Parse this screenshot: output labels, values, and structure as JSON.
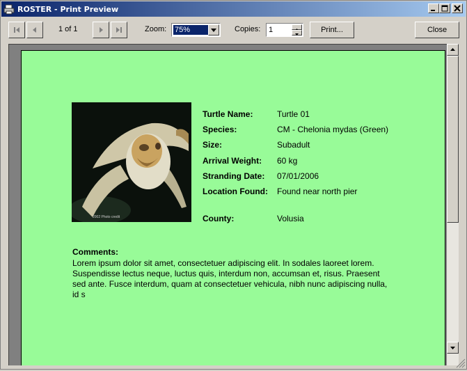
{
  "window": {
    "title": "ROSTER - Print Preview"
  },
  "toolbar": {
    "page_indicator": "1 of 1",
    "zoom_label": "Zoom:",
    "zoom_value": "75%",
    "copies_label": "Copies:",
    "copies_value": "1",
    "print_label": "Print...",
    "close_label": "Close"
  },
  "record": {
    "fields": [
      {
        "label": "Turtle Name:",
        "value": "Turtle 01"
      },
      {
        "label": "Species:",
        "value": "CM - Chelonia mydas (Green)"
      },
      {
        "label": "Size:",
        "value": "Subadult"
      },
      {
        "label": "Arrival Weight:",
        "value": "60 kg"
      },
      {
        "label": "Stranding Date:",
        "value": "07/01/2006"
      },
      {
        "label": "Location Found:",
        "value": "Found near north pier"
      },
      {
        "label": "County:",
        "value": "Volusia"
      }
    ],
    "comments_label": "Comments:",
    "comments": "Lorem ipsum dolor sit amet, consectetuer adipiscing elit. In sodales laoreet lorem. Suspendisse lectus neque, luctus quis, interdum non, accumsan et, risus. Praesent sed ante. Fusce interdum, quam at consectetuer vehicula, nibh nunc adipiscing nulla, id s",
    "photo": {
      "icon": "turtle-photo",
      "caption": "2002 Photo credit"
    }
  },
  "colors": {
    "page_background": "#98fb98",
    "title_bar": "#0a246a",
    "window": "#d4d0c8"
  }
}
